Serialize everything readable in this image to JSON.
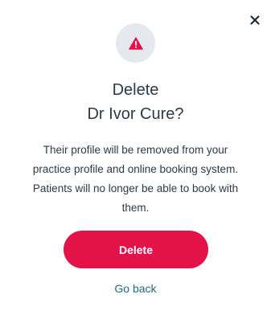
{
  "dialog": {
    "close_icon": "close-icon",
    "warning_icon": "alert-triangle-icon",
    "title_line1": "Delete",
    "title_line2": "Dr Ivor Cure?",
    "message_lines": [
      "Their profile will be removed from your",
      "practice profile and online booking system.",
      "Patients will no longer be able to book with",
      "them."
    ],
    "confirm_label": "Delete",
    "cancel_label": "Go back"
  },
  "colors": {
    "danger": "#e3134a",
    "link": "#1e6c73",
    "text": "#2c3a48",
    "icon_circle": "#e5e9ee"
  }
}
